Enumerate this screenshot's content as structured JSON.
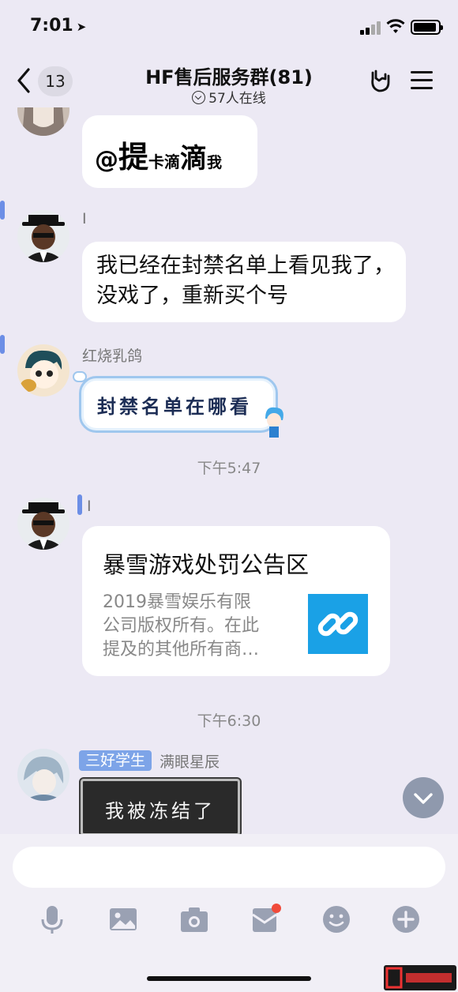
{
  "status": {
    "time": "7:01"
  },
  "nav": {
    "back_count": "13",
    "title": "HF售后服务群(81)",
    "online": "57人在线"
  },
  "messages": {
    "m1": {
      "text_parts": [
        "@",
        "提",
        "卡滴",
        "滴",
        "我"
      ]
    },
    "m2": {
      "sender": "I",
      "text": "我已经在封禁名单上看见我了，没戏了，重新买个号"
    },
    "m3": {
      "sender": "红烧乳鸽",
      "text": "封禁名单在哪看"
    },
    "time1": "下午5:47",
    "m4": {
      "sender": "I",
      "card_title": "暴雪游戏处罚公告区",
      "card_desc_1": "2019暴雪娱乐有限",
      "card_desc_2": "公司版权所有。在此",
      "card_desc_3": "提及的其他所有商…"
    },
    "time2": "下午6:30",
    "m5": {
      "title_badge": "三好学生",
      "sender": "满眼星辰",
      "text": "我被冻结了"
    }
  },
  "composer": {
    "placeholder": "",
    "tools": [
      "mic-icon",
      "image-icon",
      "camera-icon",
      "redpacket-icon",
      "emoji-icon",
      "plus-icon"
    ]
  },
  "colors": {
    "background": "#ece9f4",
    "accent": "#6c8ee6",
    "link_tile": "#1aa1e6",
    "notification_dot": "#f04a3a"
  }
}
